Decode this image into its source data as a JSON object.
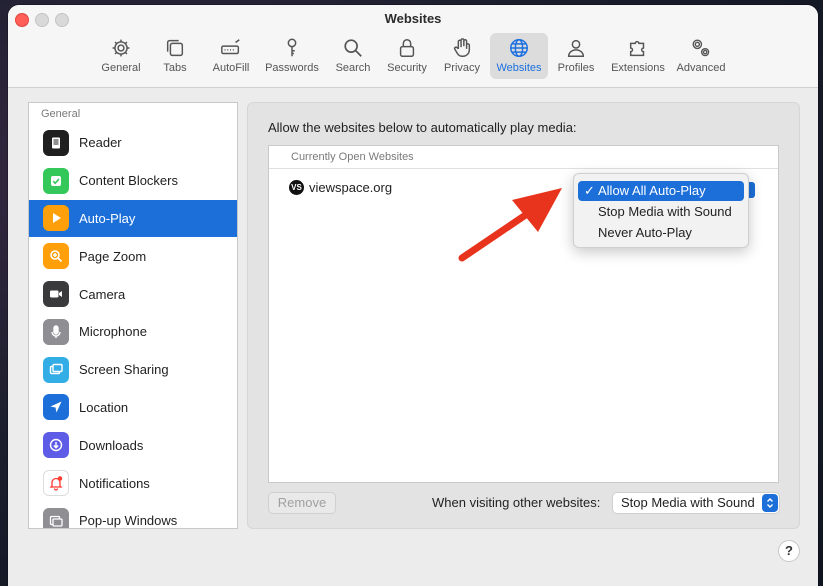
{
  "window": {
    "title": "Websites"
  },
  "toolbar": {
    "items": [
      {
        "label": "General",
        "icon": "gear-icon"
      },
      {
        "label": "Tabs",
        "icon": "tabs-icon"
      },
      {
        "label": "AutoFill",
        "icon": "autofill-icon"
      },
      {
        "label": "Passwords",
        "icon": "key-icon"
      },
      {
        "label": "Search",
        "icon": "search-icon"
      },
      {
        "label": "Security",
        "icon": "lock-icon"
      },
      {
        "label": "Privacy",
        "icon": "hand-icon"
      },
      {
        "label": "Websites",
        "icon": "globe-icon",
        "active": true
      },
      {
        "label": "Profiles",
        "icon": "person-icon"
      },
      {
        "label": "Extensions",
        "icon": "puzzle-icon"
      },
      {
        "label": "Advanced",
        "icon": "gears-icon"
      }
    ]
  },
  "sidebar": {
    "header": "General",
    "items": [
      {
        "label": "Reader",
        "icon": "reader-icon",
        "color": "#1f1f1f"
      },
      {
        "label": "Content Blockers",
        "icon": "checkmark-shield-icon",
        "color": "#34c759"
      },
      {
        "label": "Auto-Play",
        "icon": "play-icon",
        "color": "#ff9f0a",
        "selected": true
      },
      {
        "label": "Page Zoom",
        "icon": "zoom-icon",
        "color": "#ff9f0a"
      },
      {
        "label": "Camera",
        "icon": "camera-icon",
        "color": "#3a3a3c"
      },
      {
        "label": "Microphone",
        "icon": "microphone-icon",
        "color": "#8e8e93"
      },
      {
        "label": "Screen Sharing",
        "icon": "screen-sharing-icon",
        "color": "#32ade6"
      },
      {
        "label": "Location",
        "icon": "location-icon",
        "color": "#1c6fd8"
      },
      {
        "label": "Downloads",
        "icon": "download-icon",
        "color": "#5e5ce6"
      },
      {
        "label": "Notifications",
        "icon": "bell-icon",
        "color": "#ff3b30"
      },
      {
        "label": "Pop-up Windows",
        "icon": "popup-windows-icon",
        "color": "#8e8e93"
      }
    ]
  },
  "main": {
    "prompt": "Allow the websites below to automatically play media:",
    "list_header": "Currently Open Websites",
    "sites": [
      {
        "logo": "VS",
        "name": "viewspace.org"
      }
    ],
    "dropdown": {
      "options": [
        "Allow All Auto-Play",
        "Stop Media with Sound",
        "Never Auto-Play"
      ],
      "check": "✓"
    },
    "remove_label": "Remove",
    "other_label": "When visiting other websites:",
    "other_value": "Stop Media with Sound"
  },
  "help": {
    "label": "?"
  },
  "colors": {
    "accent": "#1c6fd8",
    "arrow": "#e8341c"
  }
}
